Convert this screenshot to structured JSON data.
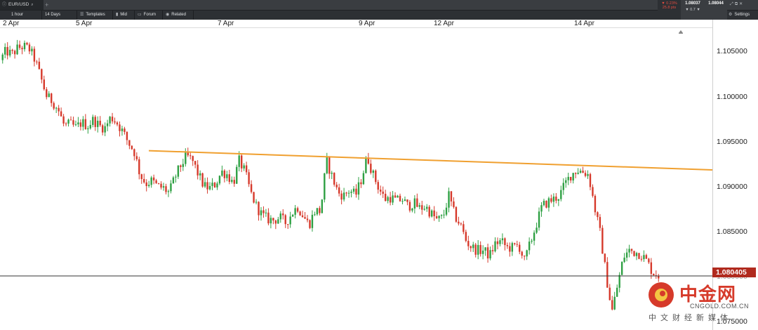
{
  "app": {
    "instrument_tab": "EUR/USD"
  },
  "toolbar": {
    "interval": "1 hour",
    "range": "14 Days",
    "templates": "Templates",
    "mid": "Mid",
    "forum": "Forum",
    "related": "Related",
    "settings": "Settings"
  },
  "quote": {
    "change_pct": "▼ 0.23%",
    "change_pips": "25.8 pts",
    "bid": "1.08037",
    "spread": "▼ 0.7 ▼",
    "ask": "1.08044"
  },
  "colors": {
    "up": "#2ea043",
    "down": "#d6392b",
    "trendline": "#f0a030",
    "price_line": "#333333",
    "price_tag": "#b02a1e"
  },
  "chart_data": {
    "type": "candlestick",
    "instrument": "EUR/USD",
    "interval": "1 hour",
    "x_ticks": [
      "2 Apr",
      "5 Apr",
      "7 Apr",
      "9 Apr",
      "12 Apr",
      "14 Apr"
    ],
    "y_ticks": [
      "1.105000",
      "1.100000",
      "1.095000",
      "1.090000",
      "1.085000",
      "1.080000",
      "1.075000"
    ],
    "ylim": [
      1.0745,
      1.1075
    ],
    "current_price": "1.080405",
    "current_price_value": 1.080405,
    "trendline": {
      "from_price": 1.0941,
      "to_price": 1.092
    },
    "close_path": [
      1.104,
      1.105,
      1.1046,
      1.1053,
      1.1055,
      1.1052,
      1.104,
      1.102,
      1.1,
      1.0995,
      1.0985,
      1.0968,
      1.097,
      1.0966,
      1.0972,
      1.0968,
      1.0975,
      1.0968,
      1.0966,
      1.0978,
      1.0972,
      1.0962,
      1.095,
      1.094,
      1.0915,
      1.0905,
      1.0908,
      1.0902,
      1.09,
      1.0895,
      1.0912,
      1.0925,
      1.0935,
      1.093,
      1.0915,
      1.0902,
      1.09,
      1.0905,
      1.0918,
      1.0915,
      1.0905,
      1.093,
      1.0918,
      1.0895,
      1.088,
      1.087,
      1.0866,
      1.0865,
      1.0868,
      1.0862,
      1.0872,
      1.088,
      1.087,
      1.086,
      1.0875,
      1.0875,
      1.093,
      1.0912,
      1.0895,
      1.0892,
      1.0898,
      1.0892,
      1.091,
      1.0935,
      1.0915,
      1.09,
      1.0888,
      1.089,
      1.0886,
      1.0888,
      1.088,
      1.0884,
      1.0878,
      1.088,
      1.0872,
      1.0865,
      1.0868,
      1.0892,
      1.087,
      1.086,
      1.0842,
      1.0835,
      1.0832,
      1.0832,
      1.0826,
      1.084,
      1.0842,
      1.0835,
      1.0835,
      1.0838,
      1.082,
      1.084,
      1.086,
      1.088,
      1.0885,
      1.0888,
      1.0892,
      1.0905,
      1.0915,
      1.092,
      1.0918,
      1.0915,
      1.088,
      1.085,
      1.0805,
      1.0765,
      1.0795,
      1.0825,
      1.0832,
      1.083,
      1.0828,
      1.082,
      1.0808,
      1.0805
    ]
  },
  "watermark": {
    "brand_cn": "中金网",
    "domain": "CNGOLD.COM.CN",
    "tagline": "中文财经新媒体"
  }
}
